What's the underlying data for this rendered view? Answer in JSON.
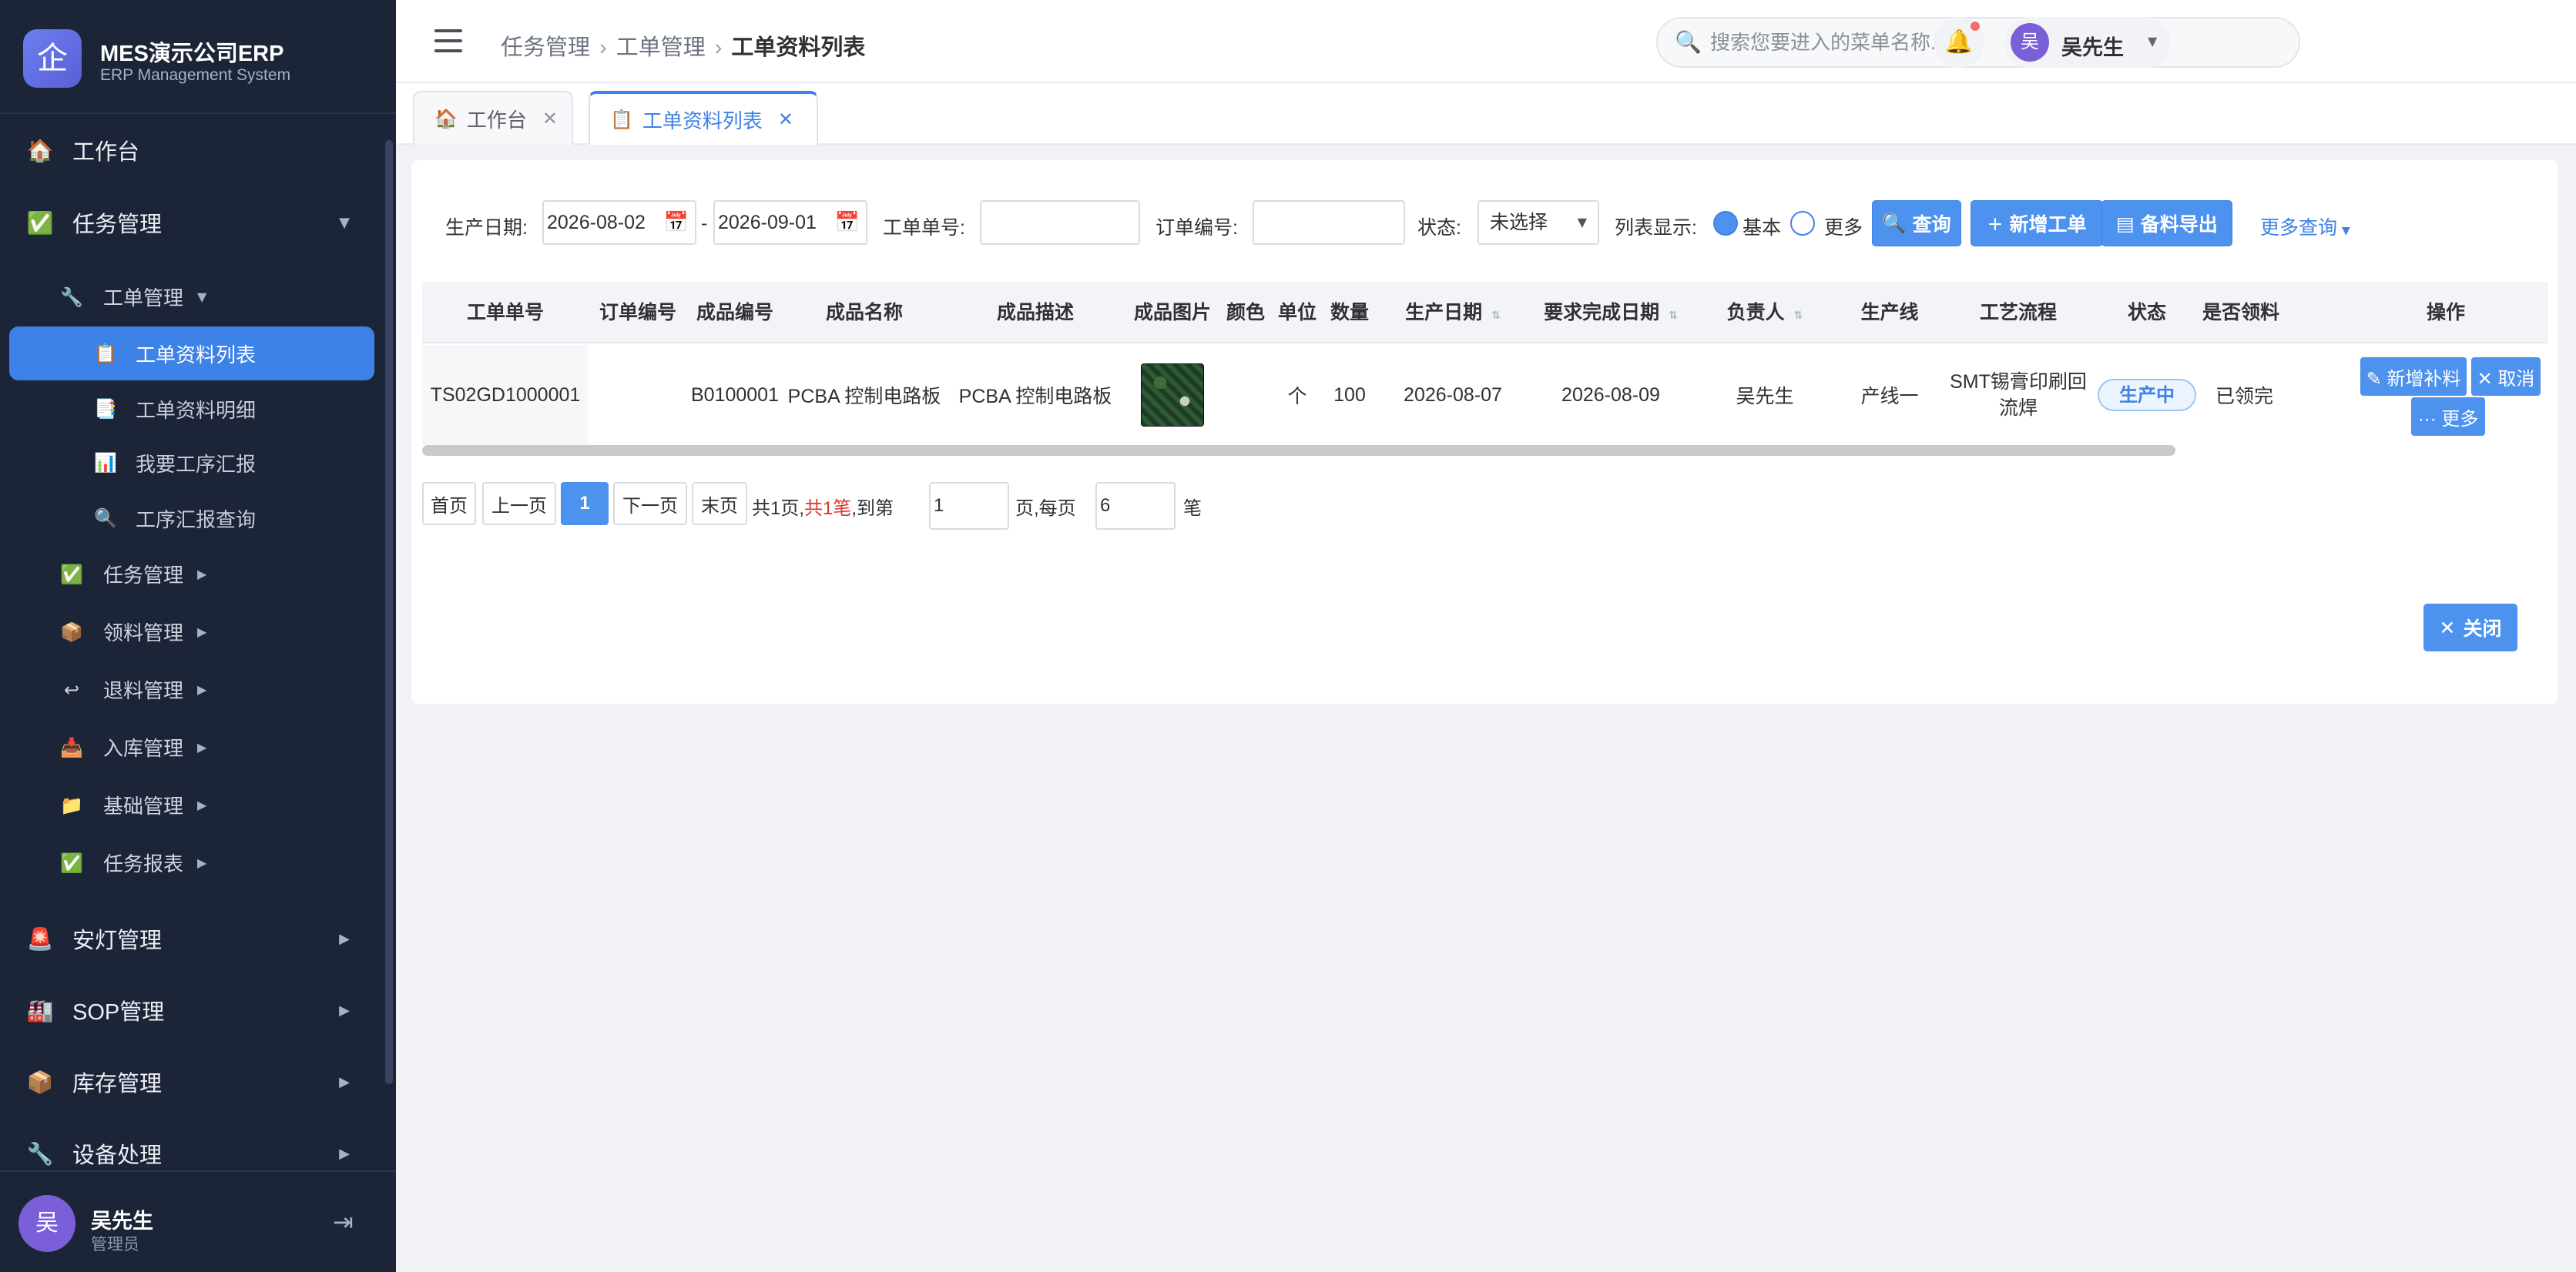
{
  "brand": {
    "title": "MES演示公司ERP",
    "subtitle": "ERP Management System",
    "logo_char": "企"
  },
  "sidebar": {
    "items": [
      {
        "icon": "🏠",
        "label": "工作台",
        "arrow": ""
      },
      {
        "icon": "✅",
        "label": "任务管理",
        "arrow": "▼"
      },
      {
        "icon": "🔧",
        "label": "工单管理",
        "arrow": "▼"
      },
      {
        "icon": "📋",
        "label": "工单资料列表",
        "arrow": ""
      },
      {
        "icon": "📑",
        "label": "工单资料明细",
        "arrow": ""
      },
      {
        "icon": "📊",
        "label": "我要工序汇报",
        "arrow": ""
      },
      {
        "icon": "🔍",
        "label": "工序汇报查询",
        "arrow": ""
      },
      {
        "icon": "✅",
        "label": "任务管理",
        "arrow": "▶"
      },
      {
        "icon": "📦",
        "label": "领料管理",
        "arrow": "▶"
      },
      {
        "icon": "↩",
        "label": "退料管理",
        "arrow": "▶"
      },
      {
        "icon": "📥",
        "label": "入库管理",
        "arrow": "▶"
      },
      {
        "icon": "📁",
        "label": "基础管理",
        "arrow": "▶"
      },
      {
        "icon": "✅",
        "label": "任务报表",
        "arrow": "▶"
      },
      {
        "icon": "🚨",
        "label": "安灯管理",
        "arrow": "▶"
      },
      {
        "icon": "🏭",
        "label": "SOP管理",
        "arrow": "▶"
      },
      {
        "icon": "📦",
        "label": "库存管理",
        "arrow": "▶"
      },
      {
        "icon": "🔧",
        "label": "设备处理",
        "arrow": "▶"
      }
    ],
    "user": {
      "avatar": "吴",
      "name": "吴先生",
      "role": "管理员",
      "logout_icon": "⇥"
    }
  },
  "header": {
    "breadcrumb": [
      "任务管理",
      "工单管理",
      "工单资料列表"
    ],
    "search_placeholder": "搜索您要进入的菜单名称...",
    "search_icon": "🔍",
    "bell_icon": "🔔",
    "user": {
      "avatar": "吴",
      "name": "吴先生",
      "caret": "▼"
    }
  },
  "tabs": [
    {
      "icon": "🏠",
      "label": "工作台",
      "close": "✕"
    },
    {
      "icon": "📋",
      "label": "工单资料列表",
      "close": "✕"
    }
  ],
  "filters": {
    "date_label": "生产日期:",
    "date_from": "2026-08-02",
    "date_sep": "-",
    "date_to": "2026-09-01",
    "calendar_icon": "📅",
    "wo_label": "工单单号:",
    "wo_value": "",
    "order_label": "订单编号:",
    "order_value": "",
    "status_label": "状态:",
    "status_value": "未选择",
    "display_label": "列表显示:",
    "radio_basic": "基本",
    "radio_more": "更多",
    "query_btn": "查询",
    "add_btn": "新增工单",
    "export_btn": "备料导出",
    "more_query": "更多查询"
  },
  "table": {
    "headers": [
      "工单单号",
      "订单编号",
      "成品编号",
      "成品名称",
      "成品描述",
      "成品图片",
      "颜色",
      "单位",
      "数量",
      "生产日期",
      "要求完成日期",
      "负责人",
      "生产线",
      "工艺流程",
      "状态",
      "是否领料",
      "操作"
    ],
    "rows": [
      {
        "wo": "TS02GD1000001",
        "order": "",
        "product_code": "B0100001",
        "product_name": "PCBA 控制电路板",
        "product_desc": "PCBA 控制电路板",
        "color": "",
        "unit": "个",
        "qty": "100",
        "prod_date": "2026-08-07",
        "due_date": "2026-08-09",
        "owner": "吴先生",
        "line": "产线一",
        "process_l1": "SMT锡膏印刷回",
        "process_l2": "流焊",
        "status": "生产中",
        "picked": "已领完",
        "op_add": "✎ 新增补料",
        "op_cancel": "✕ 取消",
        "op_more": "··· 更多"
      }
    ]
  },
  "pagination": {
    "first": "首页",
    "prev": "上一页",
    "current": "1",
    "next": "下一页",
    "last": "末页",
    "total_pages": "共1页,",
    "total_records": "共1笔",
    "goto_prefix": ",到第",
    "goto_value": "1",
    "page_suffix": "页,每页",
    "page_size": "6",
    "unit": "笔"
  },
  "close_button": "关闭"
}
